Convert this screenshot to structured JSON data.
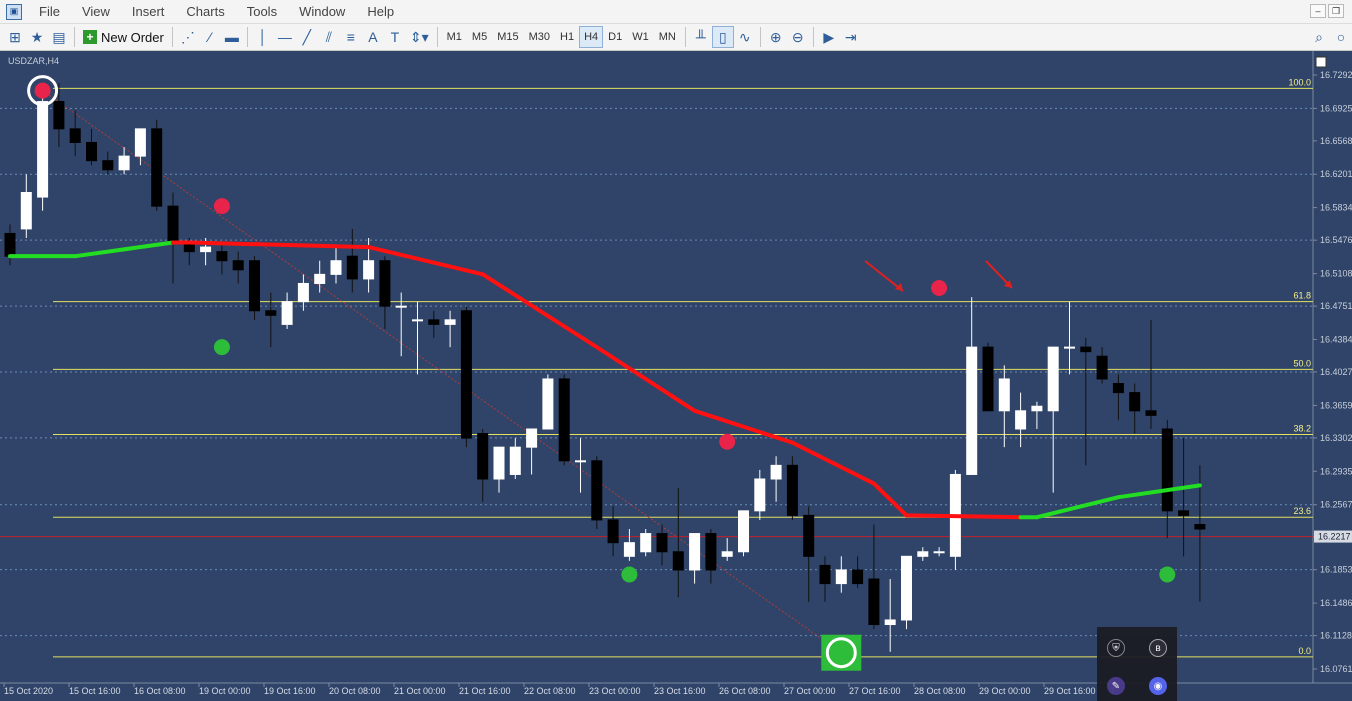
{
  "menu": {
    "items": [
      "File",
      "View",
      "Insert",
      "Charts",
      "Tools",
      "Window",
      "Help"
    ]
  },
  "toolbar": {
    "new_order_label": "New Order",
    "timeframes": [
      "M1",
      "M5",
      "M15",
      "M30",
      "H1",
      "H4",
      "D1",
      "W1",
      "MN"
    ],
    "active_timeframe": "H4"
  },
  "chart": {
    "symbol_label": "USDZAR,H4",
    "bg_color": "#2f4468",
    "current_price": "16.2217",
    "price_scale": [
      "16.7292",
      "16.6925",
      "16.6568",
      "16.6201",
      "16.5834",
      "16.5476",
      "16.5108",
      "16.4751",
      "16.4384",
      "16.4027",
      "16.3659",
      "16.3302",
      "16.2935",
      "16.2567",
      "16.2217",
      "16.1853",
      "16.1486",
      "16.1128",
      "16.0761"
    ],
    "time_scale": [
      "15 Oct 2020",
      "15 Oct 16:00",
      "16 Oct 08:00",
      "19 Oct 00:00",
      "19 Oct 16:00",
      "20 Oct 08:00",
      "21 Oct 00:00",
      "21 Oct 16:00",
      "22 Oct 08:00",
      "23 Oct 00:00",
      "23 Oct 16:00",
      "26 Oct 08:00",
      "27 Oct 00:00",
      "27 Oct 16:00",
      "28 Oct 08:00",
      "29 Oct 00:00",
      "29 Oct 16:00",
      "3"
    ],
    "fib_levels": [
      {
        "label": "100.0",
        "price": 16.7145
      },
      {
        "label": "61.8",
        "price": 16.48
      },
      {
        "label": "50.0",
        "price": 16.4055
      },
      {
        "label": "38.2",
        "price": 16.334
      },
      {
        "label": "23.6",
        "price": 16.243
      },
      {
        "label": "0.0",
        "price": 16.0895
      }
    ]
  },
  "chart_data": {
    "type": "candlestick",
    "ylim": [
      16.0761,
      16.7292
    ],
    "candles": [
      {
        "o": 16.555,
        "h": 16.565,
        "l": 16.52,
        "c": 16.53
      },
      {
        "o": 16.56,
        "h": 16.62,
        "l": 16.55,
        "c": 16.6
      },
      {
        "o": 16.595,
        "h": 16.71,
        "l": 16.58,
        "c": 16.7
      },
      {
        "o": 16.7,
        "h": 16.72,
        "l": 16.65,
        "c": 16.67
      },
      {
        "o": 16.67,
        "h": 16.69,
        "l": 16.64,
        "c": 16.655
      },
      {
        "o": 16.655,
        "h": 16.67,
        "l": 16.63,
        "c": 16.635
      },
      {
        "o": 16.635,
        "h": 16.645,
        "l": 16.62,
        "c": 16.625
      },
      {
        "o": 16.625,
        "h": 16.65,
        "l": 16.62,
        "c": 16.64
      },
      {
        "o": 16.64,
        "h": 16.66,
        "l": 16.63,
        "c": 16.67
      },
      {
        "o": 16.67,
        "h": 16.68,
        "l": 16.58,
        "c": 16.585
      },
      {
        "o": 16.585,
        "h": 16.6,
        "l": 16.5,
        "c": 16.545
      },
      {
        "o": 16.545,
        "h": 16.55,
        "l": 16.52,
        "c": 16.535
      },
      {
        "o": 16.535,
        "h": 16.55,
        "l": 16.52,
        "c": 16.54
      },
      {
        "o": 16.535,
        "h": 16.545,
        "l": 16.51,
        "c": 16.525
      },
      {
        "o": 16.525,
        "h": 16.535,
        "l": 16.5,
        "c": 16.515
      },
      {
        "o": 16.525,
        "h": 16.53,
        "l": 16.46,
        "c": 16.47
      },
      {
        "o": 16.47,
        "h": 16.49,
        "l": 16.43,
        "c": 16.465
      },
      {
        "o": 16.455,
        "h": 16.49,
        "l": 16.45,
        "c": 16.48
      },
      {
        "o": 16.48,
        "h": 16.51,
        "l": 16.47,
        "c": 16.5
      },
      {
        "o": 16.5,
        "h": 16.525,
        "l": 16.49,
        "c": 16.51
      },
      {
        "o": 16.51,
        "h": 16.54,
        "l": 16.5,
        "c": 16.525
      },
      {
        "o": 16.53,
        "h": 16.56,
        "l": 16.49,
        "c": 16.505
      },
      {
        "o": 16.505,
        "h": 16.55,
        "l": 16.49,
        "c": 16.525
      },
      {
        "o": 16.525,
        "h": 16.53,
        "l": 16.45,
        "c": 16.475
      },
      {
        "o": 16.475,
        "h": 16.49,
        "l": 16.42,
        "c": 16.475
      },
      {
        "o": 16.46,
        "h": 16.48,
        "l": 16.4,
        "c": 16.46
      },
      {
        "o": 16.46,
        "h": 16.47,
        "l": 16.44,
        "c": 16.455
      },
      {
        "o": 16.455,
        "h": 16.47,
        "l": 16.43,
        "c": 16.46
      },
      {
        "o": 16.47,
        "h": 16.475,
        "l": 16.32,
        "c": 16.33
      },
      {
        "o": 16.335,
        "h": 16.34,
        "l": 16.26,
        "c": 16.285
      },
      {
        "o": 16.285,
        "h": 16.32,
        "l": 16.27,
        "c": 16.32
      },
      {
        "o": 16.29,
        "h": 16.33,
        "l": 16.285,
        "c": 16.32
      },
      {
        "o": 16.32,
        "h": 16.34,
        "l": 16.29,
        "c": 16.34
      },
      {
        "o": 16.34,
        "h": 16.4,
        "l": 16.34,
        "c": 16.395
      },
      {
        "o": 16.395,
        "h": 16.4,
        "l": 16.3,
        "c": 16.305
      },
      {
        "o": 16.305,
        "h": 16.33,
        "l": 16.27,
        "c": 16.305
      },
      {
        "o": 16.305,
        "h": 16.31,
        "l": 16.23,
        "c": 16.24
      },
      {
        "o": 16.24,
        "h": 16.255,
        "l": 16.2,
        "c": 16.215
      },
      {
        "o": 16.2,
        "h": 16.23,
        "l": 16.195,
        "c": 16.215
      },
      {
        "o": 16.205,
        "h": 16.23,
        "l": 16.2,
        "c": 16.225
      },
      {
        "o": 16.225,
        "h": 16.235,
        "l": 16.19,
        "c": 16.205
      },
      {
        "o": 16.205,
        "h": 16.275,
        "l": 16.155,
        "c": 16.185
      },
      {
        "o": 16.185,
        "h": 16.2,
        "l": 16.17,
        "c": 16.225
      },
      {
        "o": 16.225,
        "h": 16.23,
        "l": 16.17,
        "c": 16.185
      },
      {
        "o": 16.2,
        "h": 16.22,
        "l": 16.195,
        "c": 16.205
      },
      {
        "o": 16.205,
        "h": 16.25,
        "l": 16.2,
        "c": 16.25
      },
      {
        "o": 16.25,
        "h": 16.295,
        "l": 16.24,
        "c": 16.285
      },
      {
        "o": 16.285,
        "h": 16.31,
        "l": 16.26,
        "c": 16.3
      },
      {
        "o": 16.3,
        "h": 16.31,
        "l": 16.24,
        "c": 16.245
      },
      {
        "o": 16.245,
        "h": 16.255,
        "l": 16.15,
        "c": 16.2
      },
      {
        "o": 16.19,
        "h": 16.2,
        "l": 16.15,
        "c": 16.17
      },
      {
        "o": 16.17,
        "h": 16.2,
        "l": 16.16,
        "c": 16.185
      },
      {
        "o": 16.185,
        "h": 16.2,
        "l": 16.165,
        "c": 16.17
      },
      {
        "o": 16.175,
        "h": 16.235,
        "l": 16.12,
        "c": 16.125
      },
      {
        "o": 16.125,
        "h": 16.175,
        "l": 16.095,
        "c": 16.13
      },
      {
        "o": 16.13,
        "h": 16.19,
        "l": 16.12,
        "c": 16.2
      },
      {
        "o": 16.2,
        "h": 16.21,
        "l": 16.195,
        "c": 16.205
      },
      {
        "o": 16.205,
        "h": 16.21,
        "l": 16.2,
        "c": 16.205
      },
      {
        "o": 16.2,
        "h": 16.295,
        "l": 16.185,
        "c": 16.29
      },
      {
        "o": 16.29,
        "h": 16.485,
        "l": 16.29,
        "c": 16.43
      },
      {
        "o": 16.43,
        "h": 16.435,
        "l": 16.36,
        "c": 16.36
      },
      {
        "o": 16.36,
        "h": 16.41,
        "l": 16.32,
        "c": 16.395
      },
      {
        "o": 16.34,
        "h": 16.38,
        "l": 16.32,
        "c": 16.36
      },
      {
        "o": 16.36,
        "h": 16.37,
        "l": 16.34,
        "c": 16.365
      },
      {
        "o": 16.36,
        "h": 16.43,
        "l": 16.27,
        "c": 16.43
      },
      {
        "o": 16.43,
        "h": 16.48,
        "l": 16.4,
        "c": 16.43
      },
      {
        "o": 16.43,
        "h": 16.44,
        "l": 16.3,
        "c": 16.425
      },
      {
        "o": 16.42,
        "h": 16.43,
        "l": 16.39,
        "c": 16.395
      },
      {
        "o": 16.39,
        "h": 16.4,
        "l": 16.35,
        "c": 16.38
      },
      {
        "o": 16.38,
        "h": 16.39,
        "l": 16.335,
        "c": 16.36
      },
      {
        "o": 16.36,
        "h": 16.46,
        "l": 16.34,
        "c": 16.355
      },
      {
        "o": 16.34,
        "h": 16.35,
        "l": 16.22,
        "c": 16.25
      },
      {
        "o": 16.25,
        "h": 16.33,
        "l": 16.2,
        "c": 16.245
      },
      {
        "o": 16.235,
        "h": 16.3,
        "l": 16.15,
        "c": 16.23
      }
    ],
    "ma_line": [
      {
        "i": 0,
        "v": 16.53,
        "color": "#22dd22"
      },
      {
        "i": 4,
        "v": 16.53,
        "color": "#22dd22"
      },
      {
        "i": 10,
        "v": 16.545,
        "color": "#22dd22"
      },
      {
        "i": 11,
        "v": 16.545,
        "color": "#ff1111"
      },
      {
        "i": 22,
        "v": 16.54,
        "color": "#ff1111"
      },
      {
        "i": 29,
        "v": 16.51,
        "color": "#ff1111"
      },
      {
        "i": 36,
        "v": 16.43,
        "color": "#ff1111"
      },
      {
        "i": 42,
        "v": 16.36,
        "color": "#ff1111"
      },
      {
        "i": 48,
        "v": 16.325,
        "color": "#ff1111"
      },
      {
        "i": 53,
        "v": 16.28,
        "color": "#ff1111"
      },
      {
        "i": 55,
        "v": 16.245,
        "color": "#ff1111"
      },
      {
        "i": 62,
        "v": 16.243,
        "color": "#ff1111"
      },
      {
        "i": 63,
        "v": 16.243,
        "color": "#22dd22"
      },
      {
        "i": 68,
        "v": 16.265,
        "color": "#22dd22"
      },
      {
        "i": 73,
        "v": 16.278,
        "color": "#22dd22"
      }
    ],
    "signals": [
      {
        "i": 2,
        "price": 16.712,
        "color": "#e8244a",
        "ring": true
      },
      {
        "i": 13,
        "price": 16.585,
        "color": "#e8244a",
        "ring": false
      },
      {
        "i": 13,
        "price": 16.43,
        "color": "#2ebd3a",
        "ring": false
      },
      {
        "i": 38,
        "price": 16.18,
        "color": "#2ebd3a",
        "ring": false
      },
      {
        "i": 44,
        "price": 16.326,
        "color": "#e8244a",
        "ring": false
      },
      {
        "i": 51,
        "price": 16.094,
        "color": "#2ebd3a",
        "ring": true
      },
      {
        "i": 57,
        "price": 16.495,
        "color": "#e8244a",
        "ring": false
      },
      {
        "i": 71,
        "price": 16.18,
        "color": "#2ebd3a",
        "ring": false
      }
    ]
  },
  "overlay": {
    "icons": [
      "shield-icon",
      "bs-app-icon",
      "feather-icon",
      "discord-icon"
    ]
  }
}
